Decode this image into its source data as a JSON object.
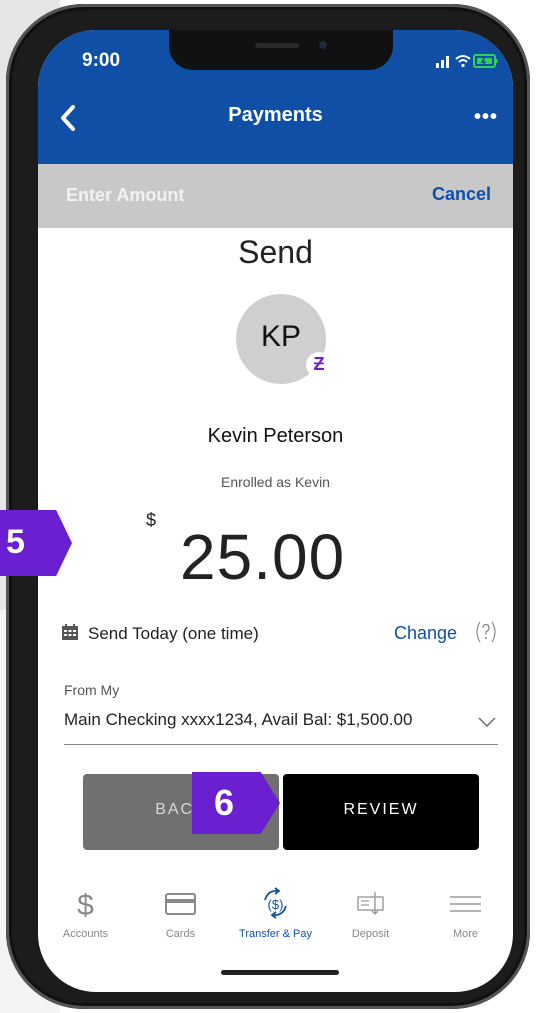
{
  "status_bar": {
    "time": "9:00"
  },
  "header": {
    "title": "Payments",
    "more": "•••"
  },
  "subbar": {
    "title": "Enter Amount",
    "cancel": "Cancel"
  },
  "send": {
    "title": "Send",
    "avatar_initials": "KP",
    "zelle_mark": "Ƶ",
    "payee_name": "Kevin Peterson",
    "enrolled_as": "Enrolled as Kevin",
    "currency": "$",
    "amount": "25.00"
  },
  "schedule": {
    "label": "Send Today (one time)",
    "change": "Change"
  },
  "from": {
    "label": "From My",
    "account": "Main Checking xxxx1234, Avail Bal: $1,500.00"
  },
  "buttons": {
    "back": "BACK",
    "review": "REVIEW"
  },
  "tabs": [
    {
      "label": "Accounts",
      "icon": "dollar-icon"
    },
    {
      "label": "Cards",
      "icon": "card-icon"
    },
    {
      "label": "Transfer & Pay",
      "icon": "transfer-icon",
      "active": true
    },
    {
      "label": "Deposit",
      "icon": "check-deposit-icon"
    },
    {
      "label": "More",
      "icon": "menu-icon"
    }
  ],
  "callouts": {
    "step5": "5",
    "step6": "6"
  },
  "colors": {
    "brand": "#0f50a6",
    "callout": "#6a1fd0",
    "zelle": "#6d1ed4"
  }
}
